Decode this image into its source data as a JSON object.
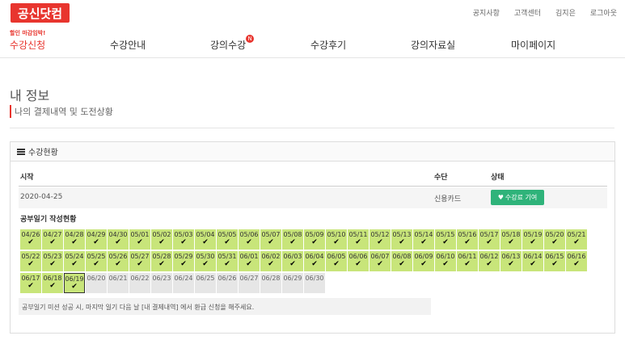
{
  "logo": "공신닷컴",
  "top_links": [
    "공지사항",
    "고객센터",
    "김지은",
    "로그아웃"
  ],
  "nav": {
    "promo": "할인 마감임박!",
    "items": [
      "수강신청",
      "수강안내",
      "강의수강",
      "수강후기",
      "강의자료실",
      "마이페이지"
    ],
    "badge": "N"
  },
  "page": {
    "title": "내 정보",
    "subtitle": "나의 결제내역 및 도전상황"
  },
  "panel": {
    "title": "수강현황",
    "columns": {
      "start": "시작",
      "method": "수단",
      "status": "상태"
    },
    "row": {
      "date": "2020-04-25",
      "method": "신용카드",
      "status_btn": "수강료 기여"
    },
    "diary_title": "공부일기 작성현황",
    "note": "공부일기 미션 성공 시, 마지막 일기 다음 날 [내 결제내역] 에서 환급 신청을 해주세요.",
    "check_glyph": "✔",
    "days": [
      {
        "d": "04/26",
        "s": "done"
      },
      {
        "d": "04/27",
        "s": "done"
      },
      {
        "d": "04/28",
        "s": "done"
      },
      {
        "d": "04/29",
        "s": "done"
      },
      {
        "d": "04/30",
        "s": "done"
      },
      {
        "d": "05/01",
        "s": "done"
      },
      {
        "d": "05/02",
        "s": "done"
      },
      {
        "d": "05/03",
        "s": "done"
      },
      {
        "d": "05/04",
        "s": "done"
      },
      {
        "d": "05/05",
        "s": "done"
      },
      {
        "d": "05/06",
        "s": "done"
      },
      {
        "d": "05/07",
        "s": "done"
      },
      {
        "d": "05/08",
        "s": "done"
      },
      {
        "d": "05/09",
        "s": "done"
      },
      {
        "d": "05/10",
        "s": "done"
      },
      {
        "d": "05/11",
        "s": "done"
      },
      {
        "d": "05/12",
        "s": "done"
      },
      {
        "d": "05/13",
        "s": "done"
      },
      {
        "d": "05/14",
        "s": "done"
      },
      {
        "d": "05/15",
        "s": "done"
      },
      {
        "d": "05/16",
        "s": "done"
      },
      {
        "d": "05/17",
        "s": "done"
      },
      {
        "d": "05/18",
        "s": "done"
      },
      {
        "d": "05/19",
        "s": "done"
      },
      {
        "d": "05/20",
        "s": "done"
      },
      {
        "d": "05/21",
        "s": "done"
      },
      {
        "d": "05/22",
        "s": "done"
      },
      {
        "d": "05/23",
        "s": "done"
      },
      {
        "d": "05/24",
        "s": "done"
      },
      {
        "d": "05/25",
        "s": "done"
      },
      {
        "d": "05/26",
        "s": "done"
      },
      {
        "d": "05/27",
        "s": "done"
      },
      {
        "d": "05/28",
        "s": "done"
      },
      {
        "d": "05/29",
        "s": "done"
      },
      {
        "d": "05/30",
        "s": "done"
      },
      {
        "d": "05/31",
        "s": "done"
      },
      {
        "d": "06/01",
        "s": "done"
      },
      {
        "d": "06/02",
        "s": "done"
      },
      {
        "d": "06/03",
        "s": "done"
      },
      {
        "d": "06/04",
        "s": "done"
      },
      {
        "d": "06/05",
        "s": "done"
      },
      {
        "d": "06/06",
        "s": "done"
      },
      {
        "d": "06/07",
        "s": "done"
      },
      {
        "d": "06/08",
        "s": "done"
      },
      {
        "d": "06/09",
        "s": "done"
      },
      {
        "d": "06/10",
        "s": "done"
      },
      {
        "d": "06/11",
        "s": "done"
      },
      {
        "d": "06/12",
        "s": "done"
      },
      {
        "d": "06/13",
        "s": "done"
      },
      {
        "d": "06/14",
        "s": "done"
      },
      {
        "d": "06/15",
        "s": "done"
      },
      {
        "d": "06/16",
        "s": "done"
      },
      {
        "d": "06/17",
        "s": "done"
      },
      {
        "d": "06/18",
        "s": "done"
      },
      {
        "d": "06/19",
        "s": "today"
      },
      {
        "d": "06/20",
        "s": "todo"
      },
      {
        "d": "06/21",
        "s": "todo"
      },
      {
        "d": "06/22",
        "s": "todo"
      },
      {
        "d": "06/23",
        "s": "todo"
      },
      {
        "d": "06/24",
        "s": "todo"
      },
      {
        "d": "06/25",
        "s": "todo"
      },
      {
        "d": "06/26",
        "s": "todo"
      },
      {
        "d": "06/27",
        "s": "todo"
      },
      {
        "d": "06/28",
        "s": "todo"
      },
      {
        "d": "06/29",
        "s": "todo"
      },
      {
        "d": "06/30",
        "s": "todo"
      }
    ]
  },
  "colors": {
    "brand": "#e8352e",
    "done": "#c8e57a",
    "todo": "#e6e6e6",
    "status_btn": "#2fb37a"
  }
}
